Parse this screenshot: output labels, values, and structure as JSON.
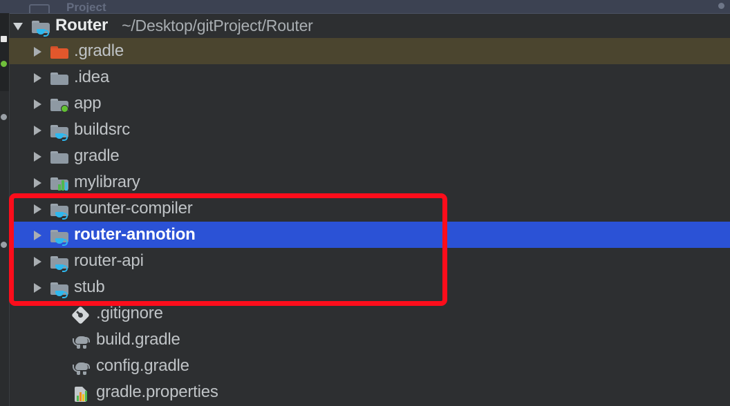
{
  "window": {
    "background_color": "#2d2f31",
    "top_strip_color": "#3c4252",
    "partial_header_text": "Project"
  },
  "project_root": {
    "name": "Router",
    "path": "~/Desktop/gitProject/Router",
    "expanded": true,
    "icon": "module-folder-gradle-icon"
  },
  "tree_rows": [
    {
      "label": ".gradle",
      "icon": "folder-orange-icon",
      "indent": 1,
      "expandable": true,
      "highlight": "olive",
      "selected": false
    },
    {
      "label": ".idea",
      "icon": "folder-icon",
      "indent": 1,
      "expandable": true,
      "highlight": "none",
      "selected": false
    },
    {
      "label": "app",
      "icon": "folder-green-dot-icon",
      "indent": 1,
      "expandable": true,
      "highlight": "none",
      "selected": false
    },
    {
      "label": "buildsrc",
      "icon": "folder-gradle-cup-icon",
      "indent": 1,
      "expandable": true,
      "highlight": "none",
      "selected": false
    },
    {
      "label": "gradle",
      "icon": "folder-icon",
      "indent": 1,
      "expandable": true,
      "highlight": "none",
      "selected": false
    },
    {
      "label": "mylibrary",
      "icon": "folder-library-bars-icon",
      "indent": 1,
      "expandable": true,
      "highlight": "none",
      "selected": false
    },
    {
      "label": "rounter-compiler",
      "icon": "folder-gradle-cup-icon",
      "indent": 1,
      "expandable": true,
      "highlight": "none",
      "selected": false
    },
    {
      "label": "router-annotion",
      "icon": "folder-gradle-cup-icon",
      "indent": 1,
      "expandable": true,
      "highlight": "none",
      "selected": true
    },
    {
      "label": "router-api",
      "icon": "folder-gradle-cup-icon",
      "indent": 1,
      "expandable": true,
      "highlight": "none",
      "selected": false
    },
    {
      "label": "stub",
      "icon": "folder-gradle-cup-icon",
      "indent": 1,
      "expandable": true,
      "highlight": "none",
      "selected": false
    },
    {
      "label": ".gitignore",
      "icon": "git-file-icon",
      "indent": 1,
      "expandable": false,
      "highlight": "none",
      "selected": false
    },
    {
      "label": "build.gradle",
      "icon": "gradle-file-icon",
      "indent": 1,
      "expandable": false,
      "highlight": "none",
      "selected": false
    },
    {
      "label": "config.gradle",
      "icon": "gradle-file-icon",
      "indent": 1,
      "expandable": false,
      "highlight": "none",
      "selected": false
    },
    {
      "label": "gradle.properties",
      "icon": "properties-file-icon",
      "indent": 1,
      "expandable": false,
      "highlight": "none",
      "selected": false
    }
  ],
  "selection": {
    "color": "#2b52d6",
    "row_label": "router-annotion"
  },
  "highlight_olive": {
    "color": "#4b452f",
    "row_label": ".gradle"
  },
  "annotation": {
    "type": "rectangle-outline",
    "color": "#fc0d1b",
    "stroke_px": 7,
    "covers_rows": [
      "rounter-compiler",
      "router-annotion",
      "router-api",
      "stub"
    ]
  },
  "gutter_icons": [
    {
      "name": "white-square-icon"
    },
    {
      "name": "green-dot-icon"
    },
    {
      "name": "gray-dot-icon"
    },
    {
      "name": "gray-dot-icon"
    }
  ]
}
